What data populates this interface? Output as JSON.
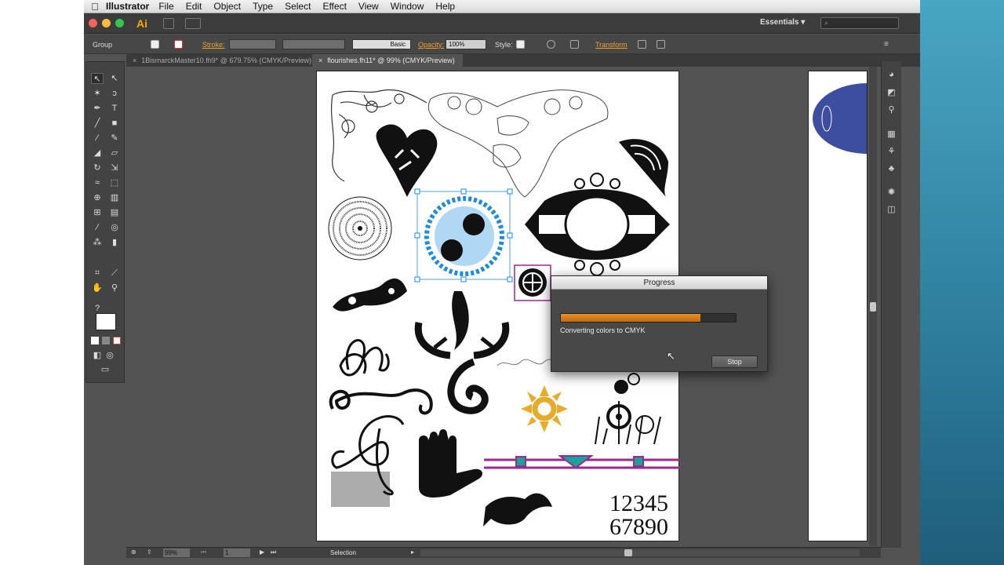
{
  "menubar": {
    "app_name": "Illustrator",
    "items": [
      "File",
      "Edit",
      "Object",
      "Type",
      "Select",
      "Effect",
      "View",
      "Window",
      "Help"
    ]
  },
  "appbar": {
    "logo": "Ai",
    "workspace": "Essentials",
    "workspace_caret": "▾"
  },
  "controlbar": {
    "selection_type": "Group",
    "stroke_label": "Stroke:",
    "brush_label": "Basic",
    "opacity_label": "Opacity:",
    "opacity_value": "100%",
    "style_label": "Style:",
    "transform_label": "Transform"
  },
  "tabs": [
    {
      "close": "×",
      "label": "1BismarckMaster10.fh9* @ 679.75% (CMYK/Preview)"
    },
    {
      "close": "×",
      "label": "flourishes.fh11* @ 99% (CMYK/Preview)"
    }
  ],
  "statusbar": {
    "zoom": "99%",
    "page": "1",
    "status": "Selection"
  },
  "dialog": {
    "title": "Progress",
    "progress": 0.8,
    "message": "Converting colors to CMYK",
    "stop_label": "Stop"
  },
  "artwork": {
    "numbers_line1": "12345",
    "numbers_line2": "67890"
  },
  "colors": {
    "accent_orange": "#f0a030",
    "progress_fill": "#d57d1c",
    "selection_blue": "#1d8be0",
    "magenta": "#9a2a8c",
    "teal": "#1aa19a",
    "gold": "#e6ac2a",
    "blue_shape": "#3d4da0"
  }
}
